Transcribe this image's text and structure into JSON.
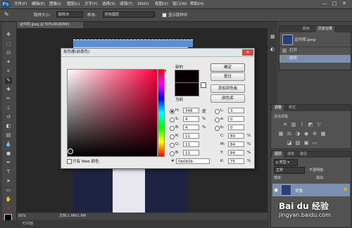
{
  "app": {
    "logo": "Ps"
  },
  "menu": [
    "文件(F)",
    "编辑(E)",
    "图像(I)",
    "图层(L)",
    "文字(Y)",
    "选择(S)",
    "滤镜(T)",
    "3D(D)",
    "视图(V)",
    "窗口(W)",
    "帮助(H)"
  ],
  "window_buttons": [
    "—",
    "□",
    "✕"
  ],
  "options_bar": {
    "size_label": "取样大小:",
    "size_value": "取样点",
    "sample_label": "样本:",
    "sample_value": "所有图层",
    "ring_label": "显示取样环"
  },
  "document_tab": "证件照.jpeg @ 50%(RGB/8#)",
  "status": {
    "zoom": "50%",
    "doc": "文档:1.9M/1.9M"
  },
  "bottom_tab": "时间轴",
  "dialog": {
    "title": "拾色器(前景色)",
    "close": "✕",
    "new_label": "新的",
    "current_label": "当前",
    "buttons": {
      "ok": "确定",
      "reset": "复位",
      "add_swatch": "添加到色板",
      "library": "颜色库"
    },
    "fields": {
      "H": {
        "label": "H:",
        "value": "348",
        "unit": "度"
      },
      "S": {
        "label": "S:",
        "value": "4",
        "unit": "%"
      },
      "B": {
        "label": "B:",
        "value": "4",
        "unit": "%"
      },
      "R": {
        "label": "R:",
        "value": "11"
      },
      "G": {
        "label": "G:",
        "value": "11"
      },
      "Bl": {
        "label": "B:",
        "value": "11"
      },
      "L": {
        "label": "L:",
        "value": "3"
      },
      "a": {
        "label": "a:",
        "value": "0"
      },
      "b": {
        "label": "b:",
        "value": "0"
      },
      "C": {
        "label": "C:",
        "value": "89",
        "unit": "%"
      },
      "M": {
        "label": "M:",
        "value": "84",
        "unit": "%"
      },
      "Y": {
        "label": "Y:",
        "value": "84",
        "unit": "%"
      },
      "K": {
        "label": "K:",
        "value": "75",
        "unit": "%"
      }
    },
    "hex_label": "#",
    "hex_value": "0b0b0b",
    "web_only": "只有 Web 颜色",
    "new_color": "#0b0b0b"
  },
  "history_panel": {
    "tabs": [
      "颜色",
      "历史记录"
    ],
    "snapshot": "证件照.jpeg",
    "items": [
      "打开",
      "魔棒"
    ]
  },
  "adjust_panel": {
    "tabs": [
      "调整",
      "样式"
    ],
    "hint": "添加调整"
  },
  "layers_panel": {
    "tabs": [
      "图层",
      "通道",
      "路径"
    ],
    "blend": "正常",
    "opacity_label": "不透明度:",
    "fill_label": "填充:",
    "lock_label": "锁定:",
    "layer_name": "背景"
  },
  "watermark": {
    "brand": "Bai du 经验",
    "url": "jingyan.baidu.com"
  }
}
